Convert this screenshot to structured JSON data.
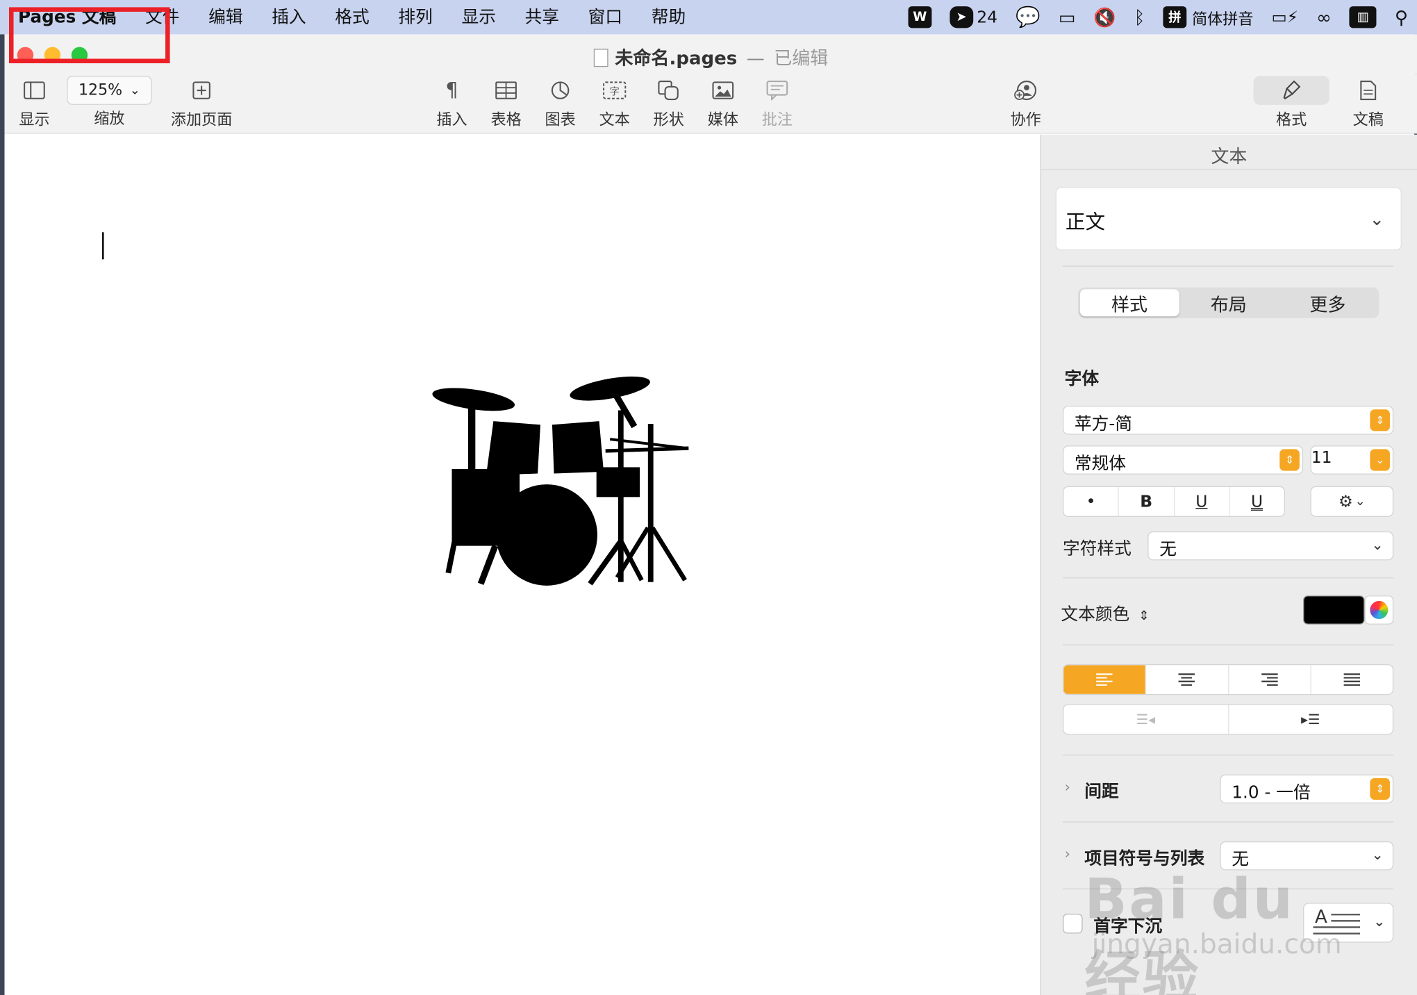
{
  "menubar": {
    "app_menu": "Pages 文稿",
    "items": [
      "文件",
      "编辑",
      "插入",
      "格式",
      "排列",
      "显示",
      "共享",
      "窗口",
      "帮助"
    ],
    "status": {
      "badge_count": "24",
      "input_method": "简体拼音",
      "input_method_badge": "拼"
    }
  },
  "window": {
    "title": "未命名.pages",
    "separator": "—",
    "edited": "已编辑"
  },
  "toolbar": {
    "view": "显示",
    "zoom_value": "125%",
    "zoom": "缩放",
    "add_page": "添加页面",
    "insert": "插入",
    "table": "表格",
    "chart": "图表",
    "text": "文本",
    "shape": "形状",
    "media": "媒体",
    "comment": "批注",
    "collaborate": "协作",
    "format": "格式",
    "document": "文稿"
  },
  "inspector": {
    "title": "文本",
    "paragraph_style": "正文",
    "tabs": [
      "样式",
      "布局",
      "更多"
    ],
    "font_section": "字体",
    "font_family": "苹方-简",
    "font_typeface": "常规体",
    "font_size": "11",
    "char_style_label": "字符样式",
    "char_style_value": "无",
    "text_color_label": "文本颜色",
    "text_color": "#000000",
    "spacing_label": "间距",
    "spacing_value": "1.0 - 一倍",
    "bullets_label": "项目符号与列表",
    "bullets_value": "无",
    "dropcap_label": "首字下沉",
    "dropcap_glyph": "A"
  },
  "watermark": {
    "brand": "Bai du 经验",
    "url": "jingyan.baidu.com"
  },
  "colors": {
    "accent": "#f5a623",
    "highlight": "#ec2127",
    "menubar": "#c8d3ef"
  }
}
